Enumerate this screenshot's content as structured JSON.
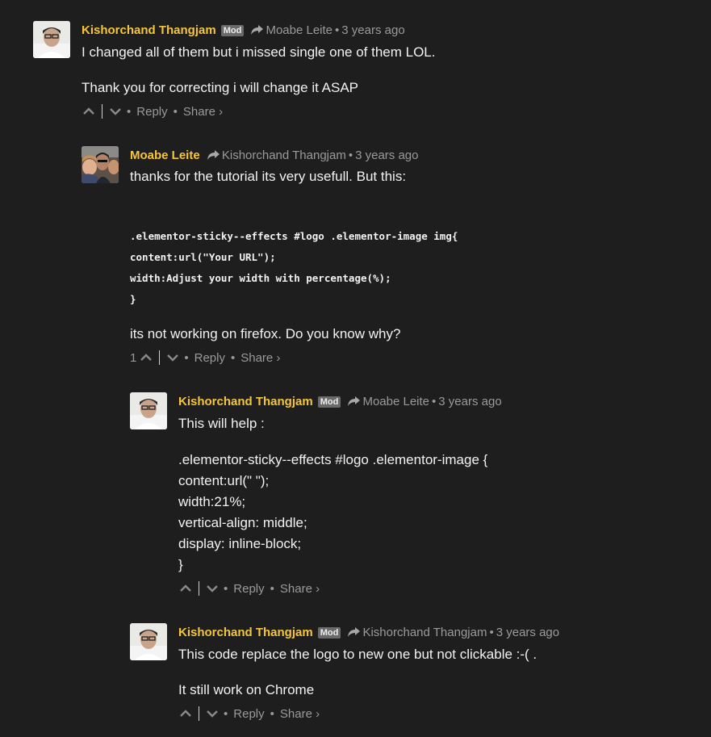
{
  "comments": [
    {
      "author": "Kishorchand Thangjam",
      "badge": "Mod",
      "reply_to": "Moabe Leite",
      "time": "3 years ago",
      "lines": [
        "I changed all of them but i missed single one of them LOL.",
        "Thank you for correcting i will change it ASAP"
      ],
      "votes": "",
      "reply_label": "Reply",
      "share_label": "Share ›"
    },
    {
      "author": "Moabe Leite",
      "badge": "",
      "reply_to": "Kishorchand Thangjam",
      "time": "3 years ago",
      "lines": [
        "thanks for the tutorial its very usefull. But this:"
      ],
      "code": [
        ".elementor-sticky--effects #logo .elementor-image img{",
        "content:url(\"Your URL\");",
        "width:Adjust your width with percentage(%);",
        "}"
      ],
      "after": "its not working on firefox. Do you know why?",
      "votes": "1",
      "reply_label": "Reply",
      "share_label": "Share ›"
    },
    {
      "author": "Kishorchand Thangjam",
      "badge": "Mod",
      "reply_to": "Moabe Leite",
      "time": "3 years ago",
      "lines": [
        "This will help :",
        ".elementor-sticky--effects #logo .elementor-image {",
        "content:url(\" \");",
        "width:21%;",
        "vertical-align: middle;",
        "display: inline-block;",
        "}"
      ],
      "votes": "",
      "reply_label": "Reply",
      "share_label": "Share ›"
    },
    {
      "author": "Kishorchand Thangjam",
      "badge": "Mod",
      "reply_to": "Kishorchand Thangjam",
      "time": "3 years ago",
      "lines": [
        "This code replace the logo to new one but not clickable :-( .",
        "It still work on Chrome"
      ],
      "votes": "",
      "reply_label": "Reply",
      "share_label": "Share ›"
    }
  ],
  "meta_separator": "•"
}
